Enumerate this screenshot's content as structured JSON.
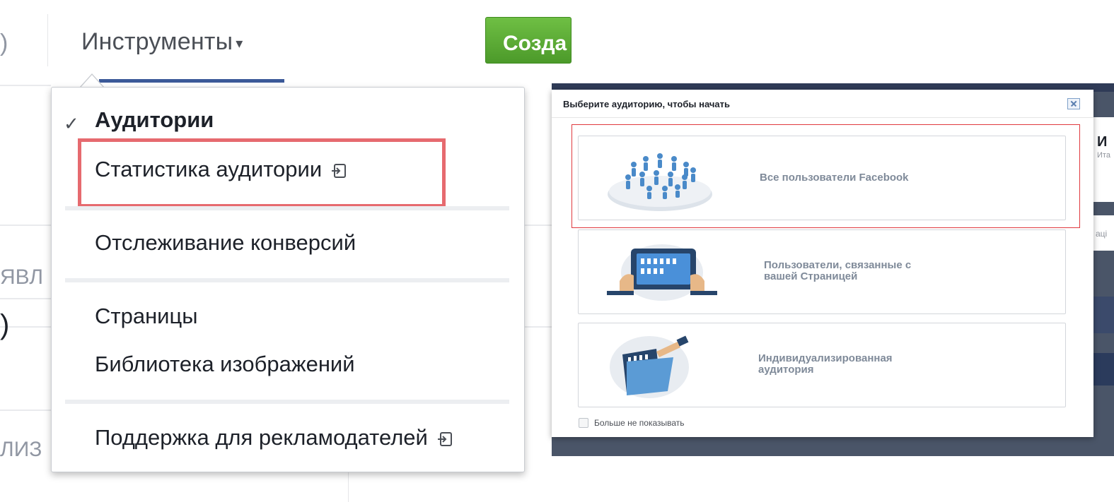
{
  "left_menu": {
    "top_left_fragment": ")",
    "tools_tab_label": "Инструменты",
    "create_button_label": "Созда",
    "background_fragments": {
      "yavl": "ЯВЛ",
      "paren": ")",
      "liz": "ЛИЗ"
    },
    "dropdown": {
      "checked_item": "Аудитории",
      "items": [
        {
          "label": "Статистика аудитории",
          "external": true
        },
        {
          "label": "Отслеживание конверсий",
          "external": false
        },
        {
          "label": "Страницы",
          "external": false
        },
        {
          "label": "Библиотека изображений",
          "external": false
        },
        {
          "label": "Поддержка для рекламодателей",
          "external": true
        }
      ]
    }
  },
  "dialog": {
    "title": "Выберите аудиторию, чтобы начать",
    "options": [
      {
        "label": "Все пользователи Facebook",
        "icon": "crowd-on-platform-icon"
      },
      {
        "label_line1": "Пользователи, связанные с",
        "label_line2": "вашей Страницей",
        "icon": "tablet-with-people-icon"
      },
      {
        "label_line1": "Индивидуализированная",
        "label_line2": "аудитория",
        "icon": "folder-with-people-icon"
      }
    ],
    "dont_show_label": "Больше не показывать"
  },
  "behind_dialog": {
    "bold_fragment": "И",
    "sub_fragment": "Ита",
    "side_fragment": "аці"
  },
  "colors": {
    "fb_blue": "#3b5998",
    "create_green": "#5aa936",
    "highlight_red": "#e66a6f",
    "option_text": "#7f8a99"
  }
}
